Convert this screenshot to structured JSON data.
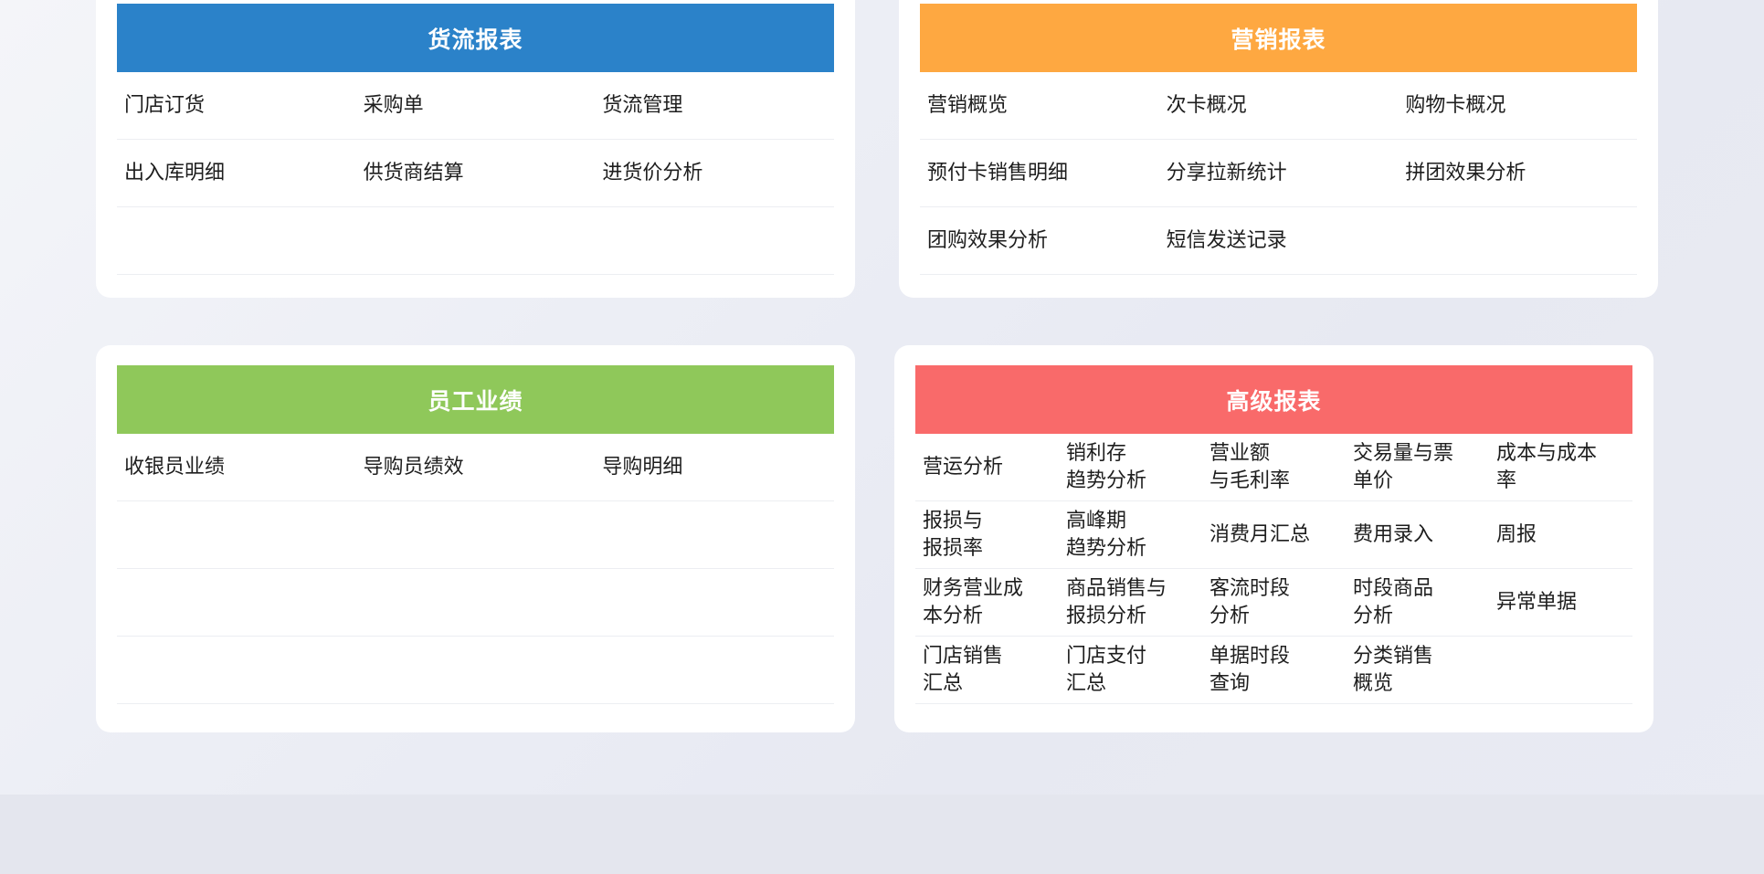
{
  "colors": {
    "flow": "#2b82c9",
    "marketing": "#fea841",
    "staff": "#8fc85a",
    "advanced": "#f96a6a"
  },
  "cards": {
    "flow": {
      "title": "货流报表",
      "rows": [
        [
          "门店订货",
          "采购单",
          "货流管理"
        ],
        [
          "出入库明细",
          "供货商结算",
          "进货价分析"
        ],
        [
          "",
          "",
          ""
        ]
      ]
    },
    "marketing": {
      "title": "营销报表",
      "rows": [
        [
          "营销概览",
          "次卡概况",
          "购物卡概况"
        ],
        [
          "预付卡销售明细",
          "分享拉新统计",
          "拼团效果分析"
        ],
        [
          "团购效果分析",
          "短信发送记录",
          ""
        ]
      ]
    },
    "staff": {
      "title": "员工业绩",
      "rows": [
        [
          "收银员业绩",
          "导购员绩效",
          "导购明细"
        ],
        [
          "",
          "",
          ""
        ],
        [
          "",
          "",
          ""
        ],
        [
          "",
          "",
          ""
        ]
      ]
    },
    "advanced": {
      "title": "高级报表",
      "rows": [
        [
          "营运分析",
          "销利存\n趋势分析",
          "营业额\n与毛利率",
          "交易量与票\n单价",
          "成本与成本\n率"
        ],
        [
          "报损与\n报损率",
          "高峰期\n趋势分析",
          "消费月汇总",
          "费用录入",
          "周报"
        ],
        [
          "财务营业成\n本分析",
          "商品销售与\n报损分析",
          "客流时段\n分析",
          "时段商品\n分析",
          "异常单据"
        ],
        [
          "门店销售\n汇总",
          "门店支付\n汇总",
          "单据时段\n查询",
          "分类销售\n概览",
          ""
        ]
      ]
    }
  }
}
